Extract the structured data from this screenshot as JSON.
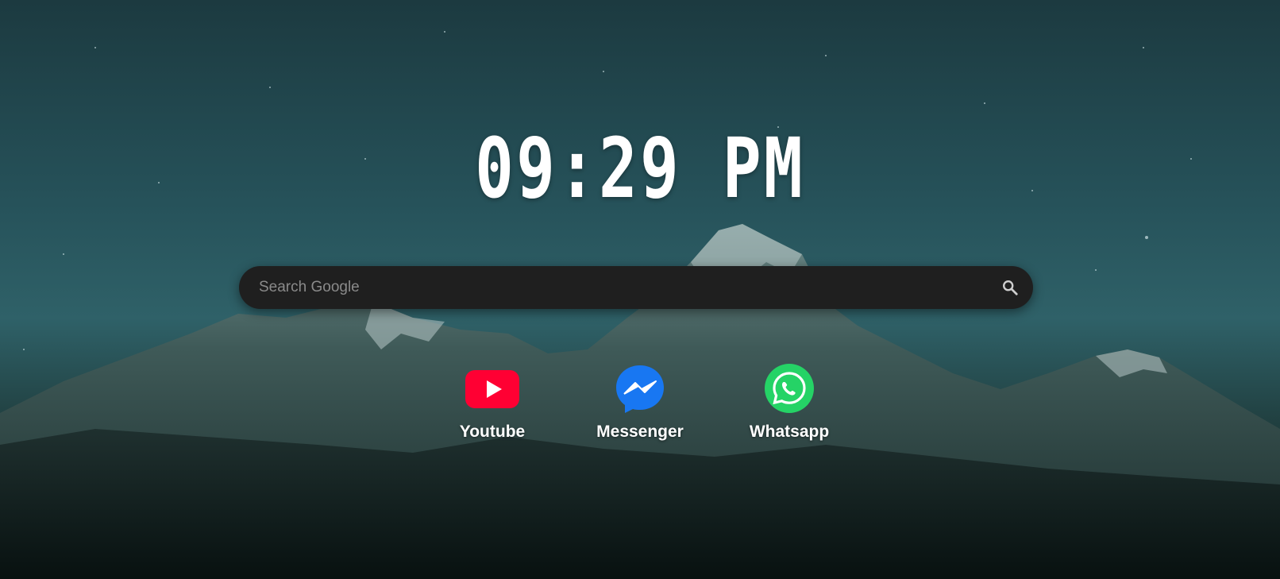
{
  "clock": {
    "time": "09:29 PM"
  },
  "search": {
    "placeholder": "Search Google",
    "value": ""
  },
  "shortcuts": [
    {
      "label": "Youtube",
      "icon": "youtube-icon",
      "color": "#ff0033"
    },
    {
      "label": "Messenger",
      "icon": "messenger-icon",
      "color": "#1877f2"
    },
    {
      "label": "Whatsapp",
      "icon": "whatsapp-icon",
      "color": "#25d366"
    }
  ],
  "colors": {
    "search_bg": "#1f1f1f",
    "text": "#ffffff"
  }
}
